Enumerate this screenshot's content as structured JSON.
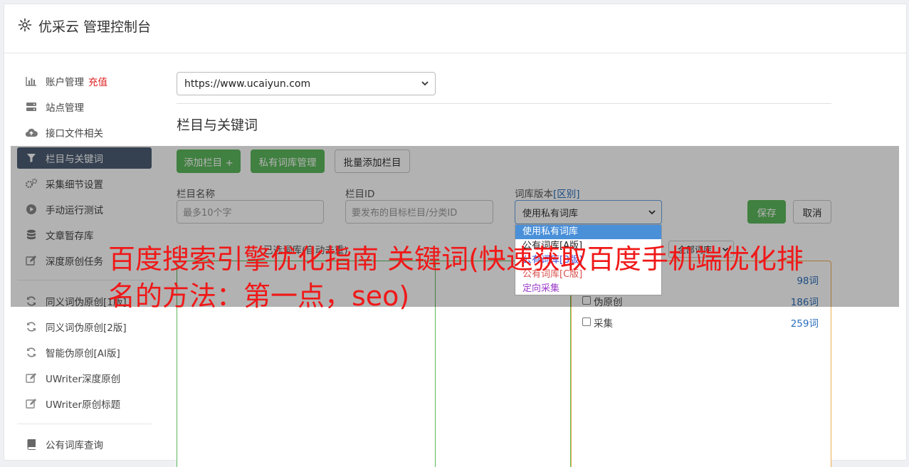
{
  "header": {
    "title": "优采云 管理控制台",
    "icon": "gear-icon"
  },
  "sidebar": {
    "items": [
      {
        "label": "账户管理",
        "extra": "充值",
        "icon": "bar-chart-icon"
      },
      {
        "label": "站点管理",
        "icon": "server-icon"
      },
      {
        "label": "接口文件相关",
        "icon": "cloud-upload-icon"
      },
      {
        "label": "栏目与关键词",
        "icon": "filter-icon",
        "active": true
      },
      {
        "label": "采集细节设置",
        "icon": "cogs-icon"
      },
      {
        "label": "手动运行测试",
        "icon": "play-circle-icon"
      },
      {
        "label": "文章暂存库",
        "icon": "database-icon"
      },
      {
        "label": "深度原创任务",
        "icon": "edit-icon"
      },
      {
        "label": "同义词伪原创[1版]",
        "icon": "refresh-icon"
      },
      {
        "label": "同义词伪原创[2版]",
        "icon": "refresh-icon"
      },
      {
        "label": "智能伪原创[AI版]",
        "icon": "refresh-icon"
      },
      {
        "label": "UWriter深度原创",
        "icon": "edit-icon"
      },
      {
        "label": "UWriter原创标题",
        "icon": "edit-icon"
      },
      {
        "label": "公有词库查询",
        "icon": "book-icon"
      }
    ]
  },
  "main": {
    "site_select": "https://www.ucaiyun.com",
    "section_title": "栏目与关键词",
    "buttons": {
      "add_column": "添加栏目 +",
      "private_lib": "私有词库管理",
      "batch_add": "批量添加栏目",
      "save": "保存",
      "cancel": "取消"
    },
    "fields": {
      "name_label": "栏目名称",
      "name_placeholder": "最多10个字",
      "id_label": "栏目ID",
      "id_placeholder": "要发布的目标栏目/分类ID",
      "version_label": "词库版本",
      "version_link": "[区别]",
      "version_value": "使用私有词库"
    },
    "version_options": [
      {
        "label": "使用私有词库",
        "color": "#ffffff",
        "selected": true
      },
      {
        "label": "公有词库[A版]",
        "color": "#222222"
      },
      {
        "label": "公有词库[B版]",
        "color": "#3b4fd8"
      },
      {
        "label": "公有词库[C版]",
        "color": "#d9534f"
      },
      {
        "label": "定向采集",
        "color": "#9b3cc9"
      }
    ],
    "column_label": "已选词库(自动去重)",
    "filter_value": "全部词库",
    "libraries": [
      {
        "name": "",
        "count": "98词"
      },
      {
        "name": "伪原创",
        "count": "186词"
      },
      {
        "name": "采集",
        "count": "259词"
      }
    ]
  },
  "overlay_text": "百度搜索引擎优化指南 关键词(快速获取百度手机端优化排名的方法：第一点，seo)"
}
